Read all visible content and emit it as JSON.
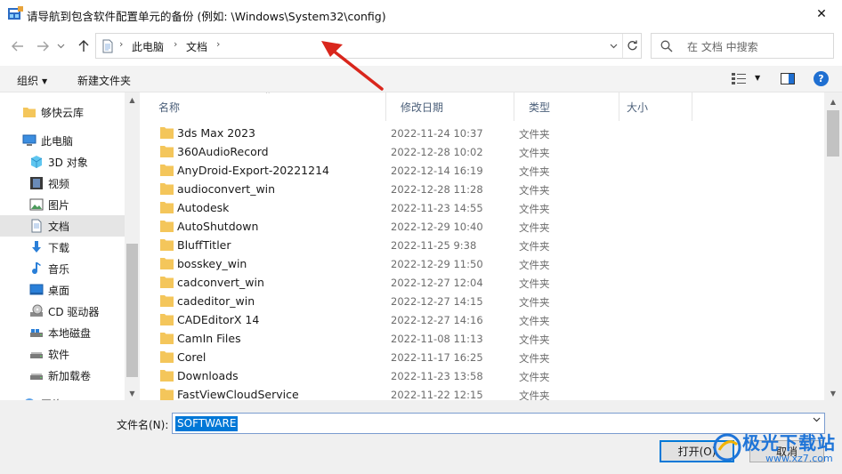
{
  "window": {
    "title": "请导航到包含软件配置单元的备份 (例如: \\Windows\\System32\\config)",
    "close_symbol": "✕"
  },
  "address": {
    "crumbs": [
      "此电脑",
      "文档"
    ],
    "separator": "›"
  },
  "search": {
    "placeholder": "在 文档 中搜索"
  },
  "toolbar": {
    "organize": "组织",
    "new_folder": "新建文件夹",
    "help": "?"
  },
  "navpane": {
    "items": [
      {
        "label": "够快云库",
        "icon": "folder-icon"
      },
      {
        "label": "此电脑",
        "icon": "computer-icon"
      },
      {
        "label": "3D 对象",
        "icon": "3d-objects-icon"
      },
      {
        "label": "视频",
        "icon": "video-icon"
      },
      {
        "label": "图片",
        "icon": "pictures-icon"
      },
      {
        "label": "文档",
        "icon": "documents-icon"
      },
      {
        "label": "下载",
        "icon": "download-icon"
      },
      {
        "label": "音乐",
        "icon": "music-icon"
      },
      {
        "label": "桌面",
        "icon": "desktop-icon"
      },
      {
        "label": "CD 驱动器",
        "icon": "cd-drive-icon"
      },
      {
        "label": "本地磁盘",
        "icon": "local-disk-icon"
      },
      {
        "label": "软件",
        "icon": "drive-icon"
      },
      {
        "label": "新加载卷",
        "icon": "drive-icon"
      },
      {
        "label": "网络",
        "icon": "network-icon"
      }
    ]
  },
  "filelist": {
    "columns": [
      "名称",
      "修改日期",
      "类型",
      "大小"
    ],
    "rows": [
      {
        "name": "3ds Max 2023",
        "date": "2022-11-24 10:37",
        "type": "文件夹"
      },
      {
        "name": "360AudioRecord",
        "date": "2022-12-28 10:02",
        "type": "文件夹"
      },
      {
        "name": "AnyDroid-Export-20221214",
        "date": "2022-12-14 16:19",
        "type": "文件夹"
      },
      {
        "name": "audioconvert_win",
        "date": "2022-12-28 11:28",
        "type": "文件夹"
      },
      {
        "name": "Autodesk",
        "date": "2022-11-23 14:55",
        "type": "文件夹"
      },
      {
        "name": "AutoShutdown",
        "date": "2022-12-29 10:40",
        "type": "文件夹"
      },
      {
        "name": "BluffTitler",
        "date": "2022-11-25 9:38",
        "type": "文件夹"
      },
      {
        "name": "bosskey_win",
        "date": "2022-12-29 11:50",
        "type": "文件夹"
      },
      {
        "name": "cadconvert_win",
        "date": "2022-12-27 12:04",
        "type": "文件夹"
      },
      {
        "name": "cadeditor_win",
        "date": "2022-12-27 14:15",
        "type": "文件夹"
      },
      {
        "name": "CADEditorX 14",
        "date": "2022-12-27 14:16",
        "type": "文件夹"
      },
      {
        "name": "CamIn Files",
        "date": "2022-11-08 11:13",
        "type": "文件夹"
      },
      {
        "name": "Corel",
        "date": "2022-11-17 16:25",
        "type": "文件夹"
      },
      {
        "name": "Downloads",
        "date": "2022-11-23 13:58",
        "type": "文件夹"
      },
      {
        "name": "FastViewCloudService",
        "date": "2022-11-22 12:15",
        "type": "文件夹"
      }
    ]
  },
  "bottom": {
    "filename_label": "文件名(N):",
    "filename_value": "SOFTWARE",
    "open_button": "打开(O)",
    "cancel_button": "取消"
  },
  "watermark": {
    "text": "极光下载站",
    "url": "www.xz7.com"
  },
  "colors": {
    "accent": "#0078d7",
    "folder": "#f4c65b",
    "arrow": "#d9261c",
    "selected": "#e5e5e5"
  }
}
